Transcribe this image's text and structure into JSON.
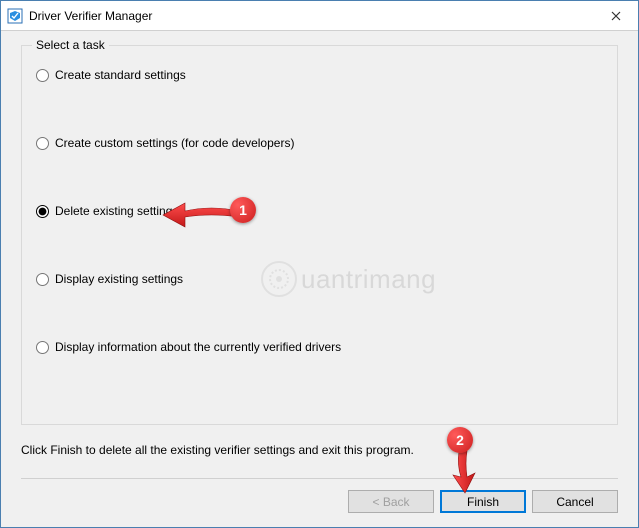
{
  "window": {
    "title": "Driver Verifier Manager"
  },
  "group": {
    "legend": "Select a task",
    "options": [
      {
        "label": "Create standard settings",
        "selected": false
      },
      {
        "label": "Create custom settings (for code developers)",
        "selected": false
      },
      {
        "label": "Delete existing settings",
        "selected": true
      },
      {
        "label": "Display existing settings",
        "selected": false
      },
      {
        "label": "Display information about the currently verified drivers",
        "selected": false
      }
    ]
  },
  "instruction": "Click Finish to delete all the existing verifier settings and exit this program.",
  "buttons": {
    "back": "< Back",
    "finish": "Finish",
    "cancel": "Cancel"
  },
  "annotations": {
    "bubble1": "1",
    "bubble2": "2",
    "watermark_text": "uantrimang"
  }
}
